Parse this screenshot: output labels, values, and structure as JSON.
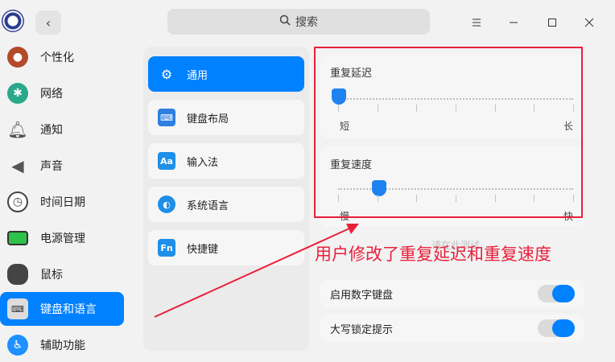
{
  "titlebar": {
    "search_placeholder": "搜索",
    "back_icon": "chevron-left-icon",
    "menu_icon": "menu-icon",
    "minimize_icon": "minimize-icon",
    "maximize_icon": "maximize-icon",
    "close_icon": "close-icon"
  },
  "sidebar": {
    "items": [
      {
        "label": "个性化",
        "icon": "personalization-icon",
        "color": "#b34a2a"
      },
      {
        "label": "网络",
        "icon": "network-icon",
        "color": "#2aa889"
      },
      {
        "label": "通知",
        "icon": "bell-icon",
        "color": "#555555"
      },
      {
        "label": "声音",
        "icon": "speaker-icon",
        "color": "#555555"
      },
      {
        "label": "时间日期",
        "icon": "clock-icon",
        "color": "#ffffff"
      },
      {
        "label": "电源管理",
        "icon": "battery-icon",
        "color": "#2ec24a"
      },
      {
        "label": "鼠标",
        "icon": "mouse-icon",
        "color": "#444444"
      },
      {
        "label": "键盘和语言",
        "icon": "keyboard-icon",
        "color": "#666666",
        "active": true
      },
      {
        "label": "辅助功能",
        "icon": "accessibility-icon",
        "color": "#1e90ff"
      }
    ]
  },
  "middle": {
    "items": [
      {
        "label": "通用",
        "icon": "gear-icon",
        "active": true
      },
      {
        "label": "键盘布局",
        "icon": "keyboard-layout-icon"
      },
      {
        "label": "输入法",
        "icon": "input-method-icon",
        "glyph": "Aa"
      },
      {
        "label": "系统语言",
        "icon": "globe-icon"
      },
      {
        "label": "快捷键",
        "icon": "shortcut-icon",
        "glyph": "Fn"
      }
    ]
  },
  "settings": {
    "repeat_delay": {
      "title": "重复延迟",
      "min_label": "短",
      "max_label": "长",
      "value_fraction": 0.0
    },
    "repeat_speed": {
      "title": "重复速度",
      "min_label": "慢",
      "max_label": "快",
      "value_fraction": 0.17
    },
    "test_placeholder": "请在此测试",
    "numlock": {
      "label": "启用数字键盘",
      "on": true
    },
    "capslock": {
      "label": "大写锁定提示",
      "on": true
    }
  },
  "annotation": {
    "text": "用户修改了重复延迟和重复速度",
    "color": "#e8203b"
  },
  "colors": {
    "accent": "#0081ff"
  }
}
